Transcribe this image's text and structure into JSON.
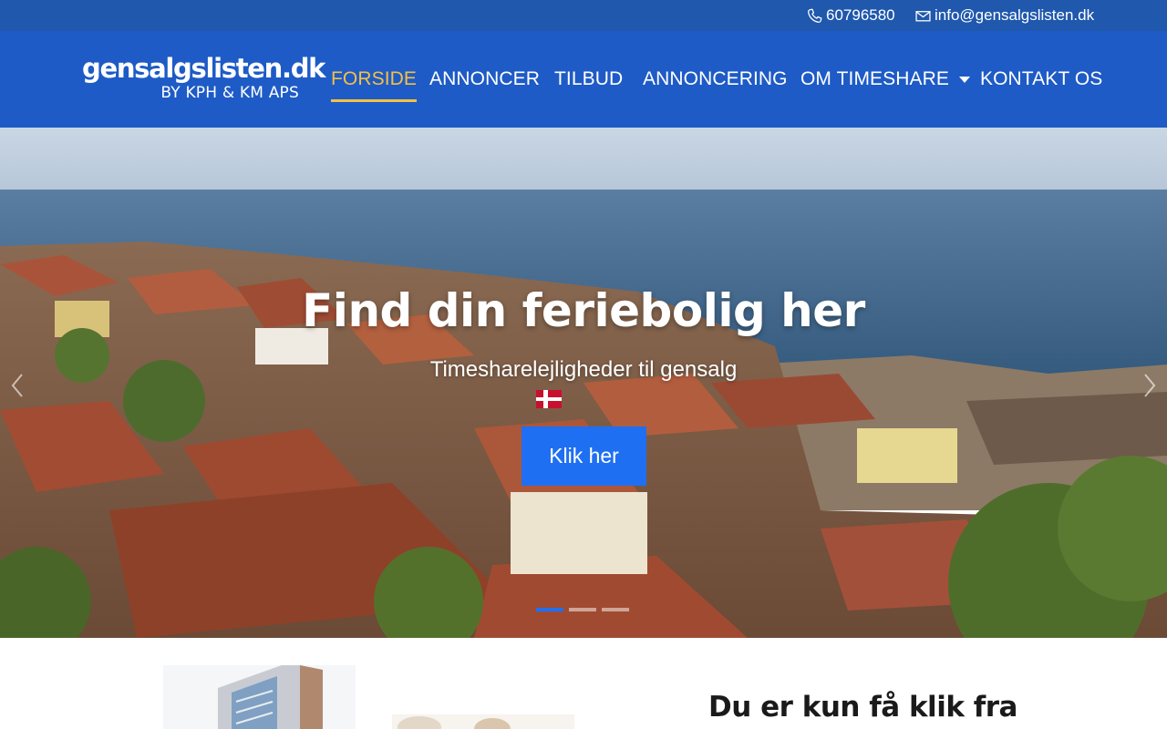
{
  "topbar": {
    "phone": "60796580",
    "email": "info@gensalgslisten.dk",
    "phone_icon": "phone-icon",
    "email_icon": "envelope-icon"
  },
  "logo": {
    "line1": "gensalgslisten.dk",
    "line2": "BY KPH & KM APS"
  },
  "nav": {
    "items": [
      {
        "label": "FORSIDE",
        "active": true
      },
      {
        "label": "ANNONCER"
      },
      {
        "label": "TILBUD"
      },
      {
        "label": "ANNONCERING"
      },
      {
        "label": "OM TIMESHARE",
        "dropdown": true
      },
      {
        "label": "KONTAKT OS"
      }
    ]
  },
  "hero": {
    "title": "Find din feriebolig her",
    "subtitle": "Timesharelejligheder til gensalg",
    "button": "Klik her",
    "slides": 3,
    "active_slide": 1
  },
  "section": {
    "heading": "Du er kun få klik fra"
  },
  "colors": {
    "topbar": "#1f58ad",
    "navbar": "#1e5bc6",
    "active_nav": "#f5c044",
    "button": "#1f6ff2"
  }
}
